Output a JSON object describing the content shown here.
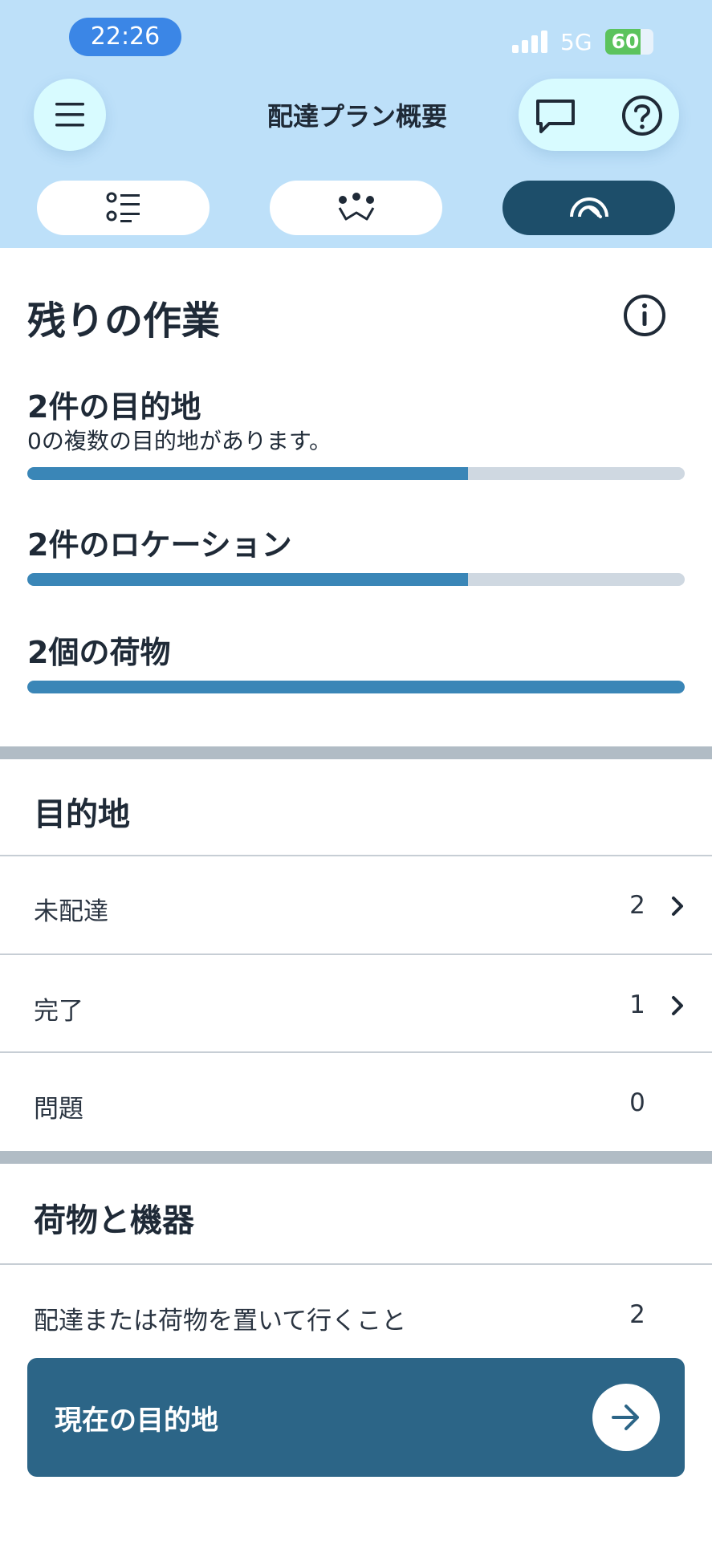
{
  "status_bar": {
    "time": "22:26",
    "network": "5G",
    "battery": "60"
  },
  "header": {
    "title": "配達プラン概要",
    "menu_icon": "hamburger-menu-icon",
    "chat_icon": "chat-bubble-icon",
    "help_icon": "question-circle-icon"
  },
  "tabs": [
    {
      "icon": "list-pins-icon",
      "active": false
    },
    {
      "icon": "route-map-icon",
      "active": false
    },
    {
      "icon": "gauge-icon",
      "active": true
    }
  ],
  "remaining_work": {
    "title": "残りの作業",
    "info_icon": "info-circle-icon",
    "metrics": [
      {
        "title": "2件の目的地",
        "subtitle": "0の複数の目的地があります。",
        "progress_percent": 67
      },
      {
        "title": "2件のロケーション",
        "subtitle": "",
        "progress_percent": 67
      },
      {
        "title": "2個の荷物",
        "subtitle": "",
        "progress_percent": 100
      }
    ]
  },
  "destinations": {
    "title": "目的地",
    "rows": [
      {
        "label": "未配達",
        "count": "2",
        "has_chevron": true
      },
      {
        "label": "完了",
        "count": "1",
        "has_chevron": true
      },
      {
        "label": "問題",
        "count": "0",
        "has_chevron": false
      }
    ]
  },
  "packages": {
    "title": "荷物と機器",
    "rows": [
      {
        "label": "配達または荷物を置いて行くこと",
        "count": "2"
      }
    ]
  },
  "cta": {
    "label": "現在の目的地",
    "icon": "arrow-right-icon"
  },
  "colors": {
    "header_bg": "#bde0f9",
    "active_tab": "#1d4e6a",
    "progress_fill": "#3a86b7",
    "progress_track": "#cfd8e1",
    "cta_bg": "#2c6587"
  }
}
